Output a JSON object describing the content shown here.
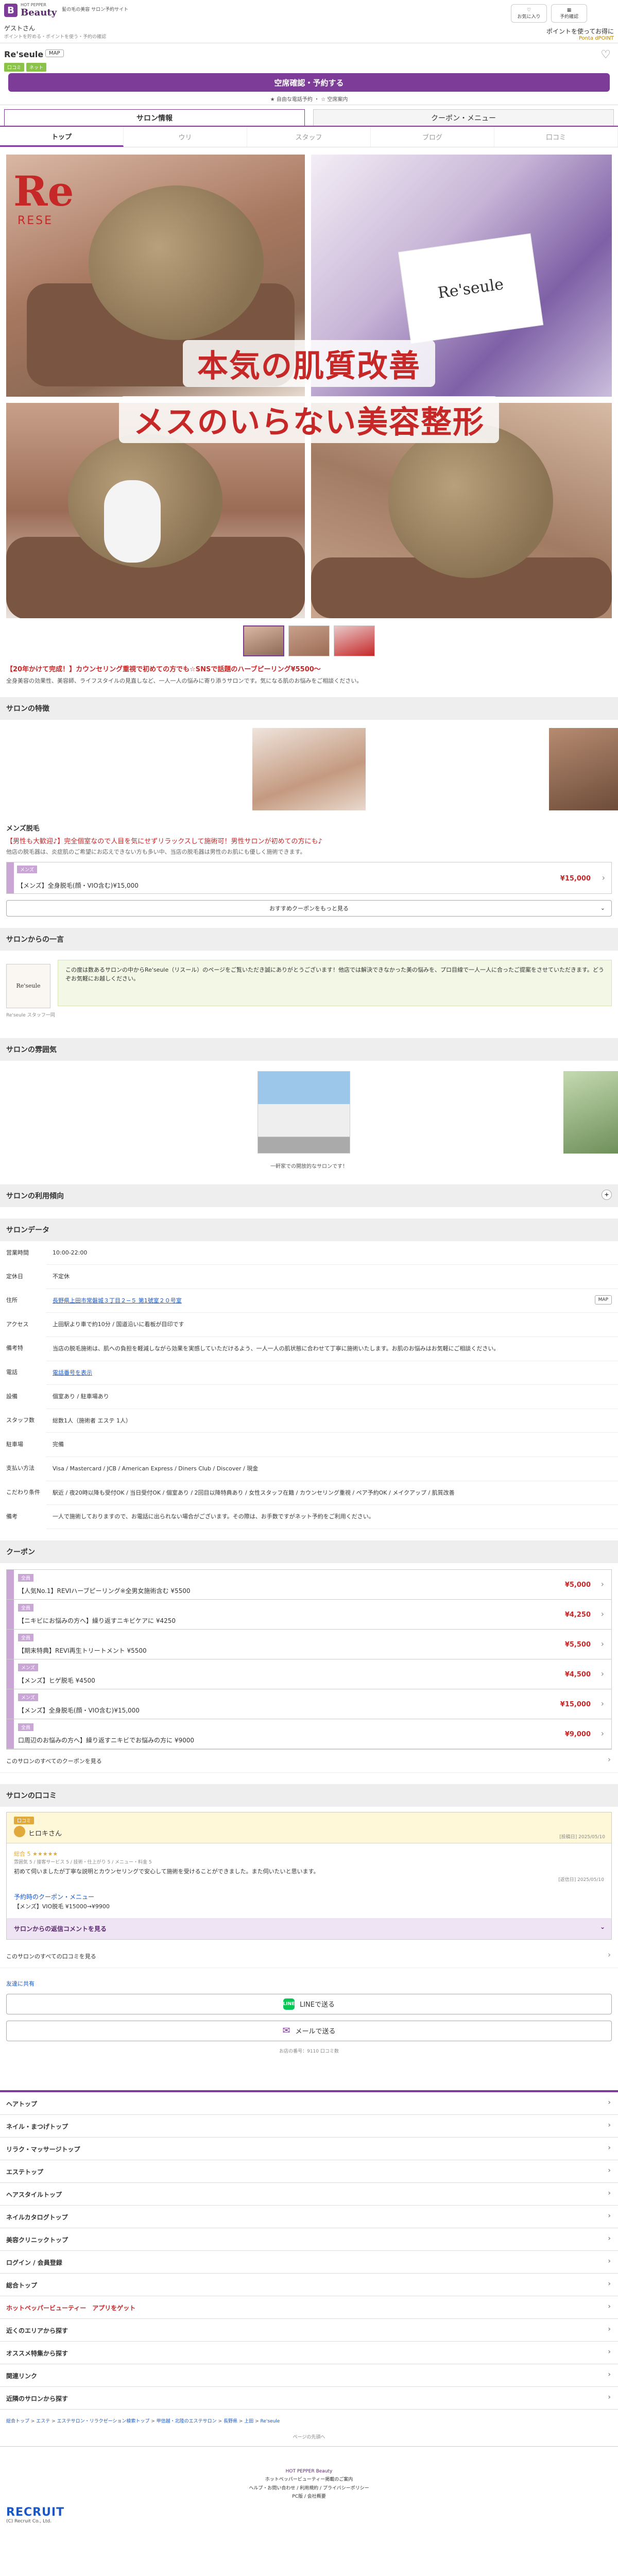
{
  "header": {
    "logo_small": "HOT PEPPER",
    "logo_big": "Beauty",
    "logo_tag": "髪の毛の美容\nサロン予約サイト",
    "guest": "ゲストさん",
    "guest_note": "ポイントを貯める・ポイントを使う・予約の確認",
    "buttons": [
      {
        "icon": "heart-icon",
        "label": "お気に入り"
      },
      {
        "icon": "calendar-icon",
        "label": "予約確認"
      }
    ],
    "points_label": "ポイントを使ってお得に",
    "points_sub": "Ponta  dPOINT"
  },
  "salon": {
    "name": "Re'seule",
    "map": "MAP",
    "tags": [
      "口コミ",
      "ネット"
    ],
    "reserve": "空席確認・予約する",
    "reserve_note": "★ 自由な電話予約 ・ ☆ 空席案内"
  },
  "tabs": [
    {
      "label": "サロン情報",
      "active": true
    },
    {
      "label": "クーポン・メニュー",
      "active": false
    }
  ],
  "subnav": [
    {
      "label": "トップ",
      "on": true
    },
    {
      "label": "ウリ",
      "on": false
    },
    {
      "label": "スタッフ",
      "on": false
    },
    {
      "label": "ブログ",
      "on": false
    },
    {
      "label": "口コミ",
      "on": false
    }
  ],
  "gallery": {
    "logo": "Re",
    "logo_sub": "RESE",
    "card": "Re'seule",
    "overlay1": "本気の肌質改善",
    "overlay2": "メスのいらない美容整形"
  },
  "lead": {
    "headline": "【20年かけて完成！】カウンセリング重視で初めての方でも☆SNSで話題のハーブピーリング¥5500〜",
    "body": "全身美容の効果性、美容師、ライフスタイルの見直しなど、一人一人の悩みに寄り添うサロンです。気になる肌のお悩みをご相談ください。"
  },
  "sections": {
    "features": "サロンの特徴",
    "message": "サロンからの一言",
    "atmosphere": "サロンの雰囲気",
    "usage": "サロンの利用傾向",
    "data": "サロンデータ",
    "coupons": "クーポン",
    "reviews": "サロンの口コミ"
  },
  "mens": {
    "title": "メンズ脱毛",
    "tagline": "【男性も大歓迎♪】完全個室なので人目を気にせずリラックスして施術可！男性サロンが初めての方にも♪",
    "desc": "他店の脱毛器は、炎症肌のご希望にお応えできない方も多い中、当店の脱毛器は男性のお肌にも優しく施術できます。",
    "coupon_badge": "メンズ",
    "coupon_name": "【メンズ】全身脱毛(顔・VIO含む)¥15,000",
    "coupon_price": "¥15,000",
    "more": "おすすめクーポンをもっと見る"
  },
  "message": {
    "avatar": "Re'seule",
    "text": "この度は数あるサロンの中からRe'seule（リスール）のページをご覧いただき誠にありがとうございます！他店では解決できなかった美の悩みを、プロ目線で一人一人に合ったご提案をさせていただきます。どうぞお気軽にお越しください。",
    "name": "Re'seule スタッフ一同"
  },
  "atmosphere": {
    "caption": "一軒家での開放的なサロンです！"
  },
  "usage": {
    "toggle": "+"
  },
  "data_rows": [
    {
      "label": "営業時間",
      "value": "10:00-22:00"
    },
    {
      "label": "定休日",
      "value": "不定休"
    },
    {
      "label": "住所",
      "value": "長野県上田市常磐城３丁目２−５ 第1號室２０号室",
      "link": true,
      "map": "MAP"
    },
    {
      "label": "アクセス",
      "value": "上田駅より車で約10分 / 国道沿いに看板が目印です"
    },
    {
      "label": "備考特",
      "value": "当店の脱毛施術は、肌への負担を軽減しながら効果を実感していただけるよう、一人一人の肌状態に合わせて丁寧に施術いたします。お肌のお悩みはお気軽にご相談ください。"
    },
    {
      "label": "電話",
      "value": "電話番号を表示",
      "link": true
    },
    {
      "label": "設備",
      "value": "個室あり / 駐車場あり"
    },
    {
      "label": "スタッフ数",
      "value": "総数1人（施術者 エステ 1人）"
    },
    {
      "label": "駐車場",
      "value": "完備"
    },
    {
      "label": "支払い方法",
      "value": "Visa / Mastercard / JCB / American Express / Diners Club / Discover / 現金"
    },
    {
      "label": "こだわり条件",
      "value": "駅近 / 夜20時以降も受付OK / 当日受付OK / 個室あり / 2回目以降特典あり / 女性スタッフ在籍 / カウンセリング重視 / ペア予約OK / メイクアップ / 肌質改善"
    },
    {
      "label": "備考",
      "value": "一人で施術しておりますので、お電話に出られない場合がございます。その際は、お手数ですがネット予約をご利用ください。"
    }
  ],
  "coupon_list": [
    {
      "badge": "全員",
      "name": "【人気No.1】REVIハーブピーリング※全男女施術含む ¥5500",
      "price": "¥5,000"
    },
    {
      "badge": "全員",
      "name": "【ニキビにお悩みの方へ】繰り返すニキビケアに ¥4250",
      "price": "¥4,250"
    },
    {
      "badge": "全員",
      "name": "【期末特典】REVI再生トリートメント ¥5500",
      "price": "¥5,500"
    },
    {
      "badge": "メンズ",
      "name": "【メンズ】ヒゲ脱毛 ¥4500",
      "price": "¥4,500"
    },
    {
      "badge": "メンズ",
      "name": "【メンズ】全身脱毛(顔・VIO含む)¥15,000",
      "price": "¥15,000"
    },
    {
      "badge": "全員",
      "name": "口周辺のお悩みの方へ】繰り返すニキビでお悩みの方に ¥9000",
      "price": "¥9,000"
    }
  ],
  "coupon_more": "このサロンのすべてのクーポンを見る",
  "review": {
    "label": "口コミ",
    "who": "ヒロキさん",
    "date": "[投稿日] 2025/05/10",
    "stars": "総合 5 ★★★★★",
    "category": "雰囲気 5 / 接客サービス 5 / 技術・仕上がり 5 / メニュー・料金 5",
    "text": "初めて伺いましたが丁寧な説明とカウンセリングで安心して施術を受けることができました。また伺いたいと思います。",
    "menu_title": "予約時のクーポン・メニュー",
    "menu_name": "【メンズ】VIO脱毛 ¥15000→¥9900",
    "reply_date": "[返信日] 2025/05/10",
    "reply": "サロンからの返信コメントを見る"
  },
  "review_more": "このサロンのすべての口コミを見る",
  "contact": {
    "title": "友達に共有",
    "line": "LINEで送る",
    "mail": "メールで送る",
    "note": "お店の番号：9110  口コミ数"
  },
  "footer_rows": [
    {
      "label": "ヘアトップ",
      "red": false
    },
    {
      "label": "ネイル・まつげトップ",
      "red": false
    },
    {
      "label": "リラク・マッサージトップ",
      "red": false
    },
    {
      "label": "エステトップ",
      "red": false
    },
    {
      "label": "ヘアスタイルトップ",
      "red": false
    },
    {
      "label": "ネイルカタログトップ",
      "red": false
    },
    {
      "label": "美容クリニックトップ",
      "red": false
    },
    {
      "label": "ログイン / 会員登録",
      "red": false
    },
    {
      "label": "総合トップ",
      "red": false
    },
    {
      "label": "ホットペッパービューティー　アプリをゲット",
      "red": true
    },
    {
      "label": "近くのエリアから探す",
      "red": false
    },
    {
      "label": "オススメ特集から探す",
      "red": false
    },
    {
      "label": "関連リンク",
      "red": false
    },
    {
      "label": "近隣のサロンから探す",
      "red": false
    }
  ],
  "breadcrumb": [
    "総合トップ",
    "エステ",
    "エステサロン・リラクゼーション検索トップ",
    "甲信越・北陸のエステサロン",
    "長野県",
    "上田",
    "Re'seule"
  ],
  "pagetop": "ページの先頭へ",
  "footer_links": {
    "site": "HOT PEPPER Beauty",
    "l1": "ホットペッパービューティー掲載のご案内",
    "l2": "ヘルプ・お問い合わせ / 利用規約 / プライバシーポリシー",
    "l3": "PC版 / 会社概要"
  },
  "recruit": {
    "logo": "RECRUIT",
    "copy": "(C) Recruit Co., Ltd."
  }
}
